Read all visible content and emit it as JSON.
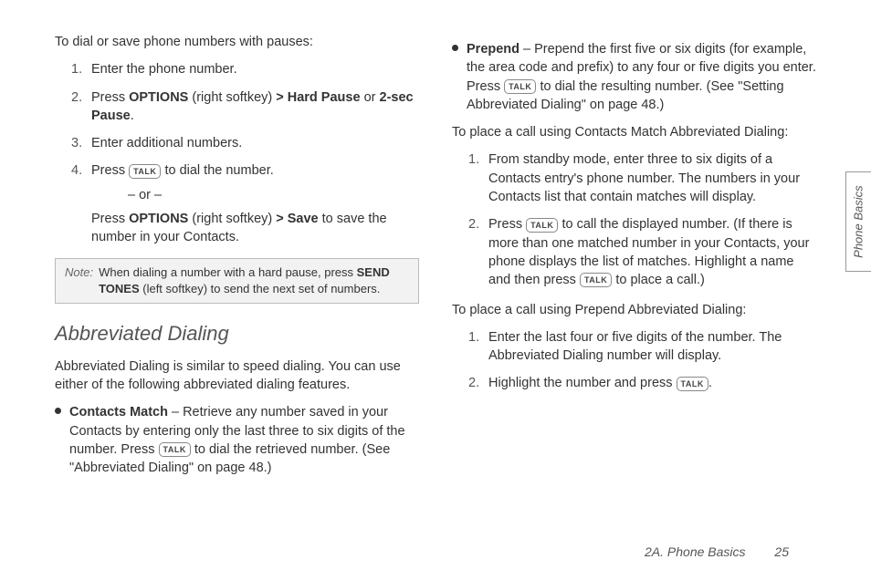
{
  "left": {
    "intro": "To dial or save phone numbers with pauses:",
    "steps": {
      "s1": "Enter the phone number.",
      "s2a": "Press ",
      "s2b": "OPTIONS",
      "s2c": " (right softkey) ",
      "s2gt": ">",
      "s2d": " Hard Pause",
      "s2e": " or ",
      "s2f": "2-sec Pause",
      "s2g": ".",
      "s3": "Enter additional numbers.",
      "s4a": "Press ",
      "s4b": " to dial the number.",
      "or": "– or –",
      "s4c": "Press ",
      "s4d": "OPTIONS",
      "s4e": " (right softkey) ",
      "s4gt": ">",
      "s4f": " Save",
      "s4g": " to save the number in your Contacts."
    },
    "note": {
      "label": "Note:",
      "a": "When dialing a number with a hard pause, press ",
      "b": "SEND TONES",
      "c": " (left softkey) to send the next set of numbers."
    },
    "heading": "Abbreviated Dialing",
    "desc": "Abbreviated Dialing is similar to speed dialing. You can use either of the following abbreviated dialing features.",
    "bullet1": {
      "title": "Contacts Match",
      "a": " – Retrieve any number saved in your Contacts by entering only the last three to six digits of the number. Press ",
      "b": " to dial the retrieved number. (See \"Abbreviated Dialing\" on page 48.)"
    }
  },
  "right": {
    "bullet2": {
      "title": "Prepend",
      "a": " – Prepend the first five or six digits (for example, the area code and prefix) to any four or five digits you enter. Press ",
      "b": " to dial the resulting number. (See \"Setting Abbreviated Dialing\" on page 48.)"
    },
    "h1": "To place a call using Contacts Match Abbreviated Dialing:",
    "cm": {
      "s1": "From standby mode, enter three to six digits of a Contacts entry's phone number. The numbers in your Contacts list that contain matches will display.",
      "s2a": "Press ",
      "s2b": " to call the displayed number. (If there is more than one matched number in your Contacts, your phone displays the list of matches. Highlight a name and then press ",
      "s2c": " to place a call.)"
    },
    "h2": "To place a call using Prepend Abbreviated Dialing:",
    "pp": {
      "s1": "Enter the last four or five digits of the number. The Abbreviated Dialing number will display.",
      "s2a": "Highlight the number and press ",
      "s2b": "."
    }
  },
  "sidetab": "Phone Basics",
  "footer": {
    "section": "2A. Phone Basics",
    "page": "25"
  },
  "talk": "TALK"
}
